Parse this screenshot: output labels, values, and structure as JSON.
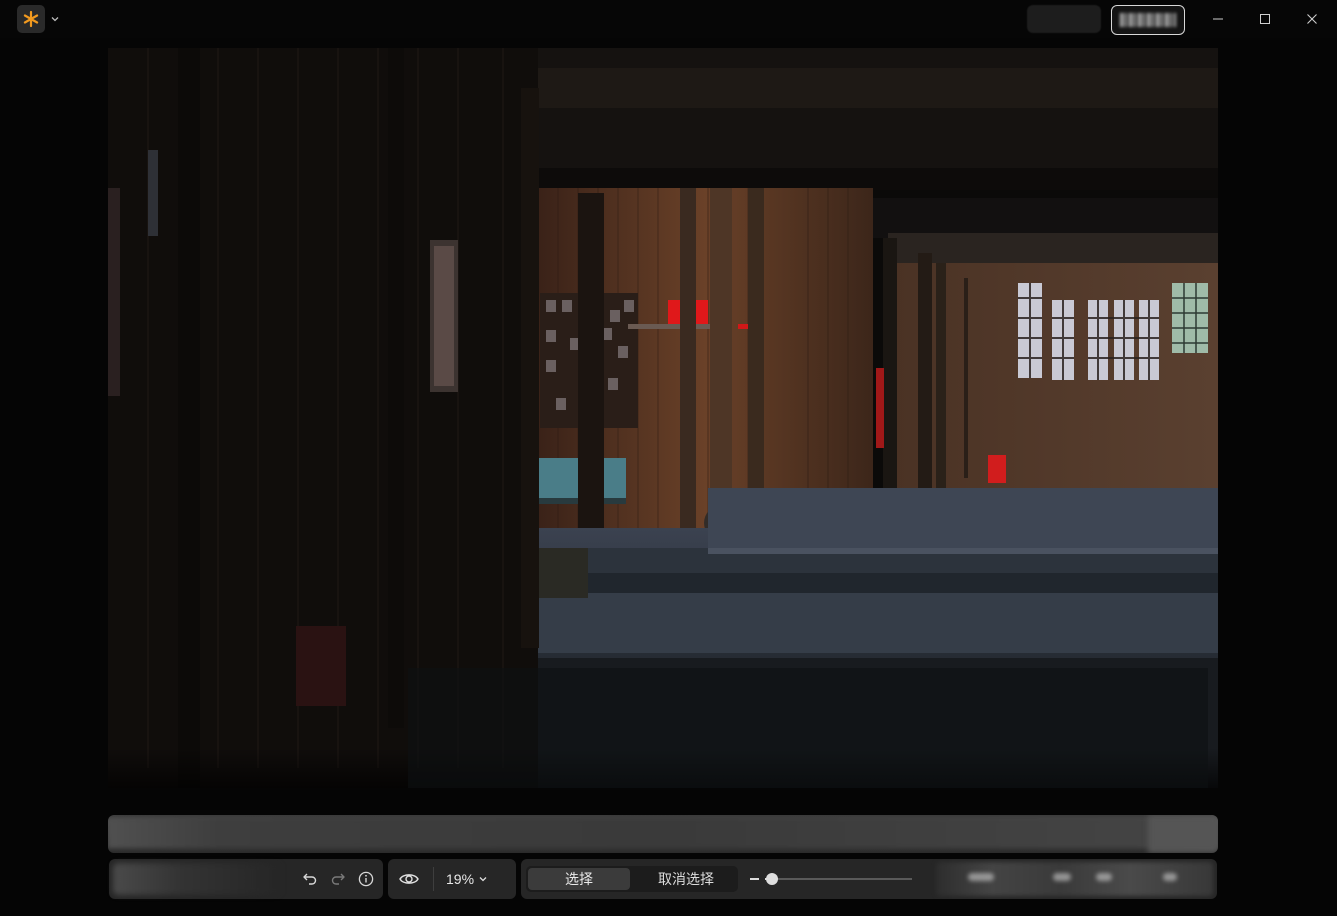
{
  "window": {
    "app_icon": "asterisk-icon",
    "accent_color": "#f29a1f",
    "controls": [
      "minimize-icon",
      "maximize-icon",
      "close-icon"
    ]
  },
  "photo": {
    "subject": "dark-courtyard-photo"
  },
  "toolbar": {
    "undo_icon": "undo-icon",
    "redo_icon": "redo-icon",
    "info_icon": "info-icon",
    "visibility_icon": "eye-icon",
    "zoom_value": "19%",
    "select_label": "选择",
    "deselect_label": "取消选择",
    "brush_size_level": 0.05
  }
}
